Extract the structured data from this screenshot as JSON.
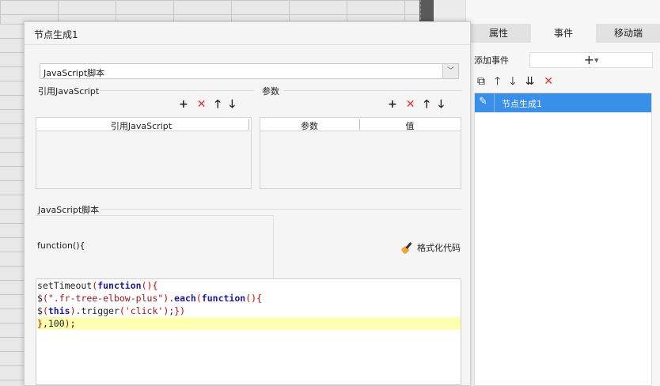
{
  "dialog": {
    "title": "节点生成1",
    "script_type": "JavaScript脚本",
    "ref_js_label": "引用JavaScript",
    "params_label": "参数",
    "ref_table": {
      "columns": [
        "引用JavaScript"
      ]
    },
    "params_table": {
      "columns": [
        "参数",
        "值"
      ]
    },
    "script_section_label": "JavaScript脚本",
    "function_header": "function(){",
    "format_code_label": "格式化代码",
    "code_lines": [
      "setTimeout(function(){",
      "$(\".fr-tree-elbow-plus\").each(function(){",
      "$(this).trigger('click');})",
      "},100);"
    ]
  },
  "right_panel": {
    "tabs": [
      "属性",
      "事件",
      "移动端"
    ],
    "active_tab": "事件",
    "add_event_label": "添加事件",
    "add_event_button": "+",
    "events": [
      {
        "label": "节点生成1",
        "selected": true
      }
    ]
  },
  "icons": {
    "add": "+",
    "delete": "✕",
    "up": "🡑",
    "down": "🡓"
  },
  "colors": {
    "selection": "#3a8fe8",
    "delete_red": "#e5322d",
    "code_highlight": "#ffffb0"
  }
}
